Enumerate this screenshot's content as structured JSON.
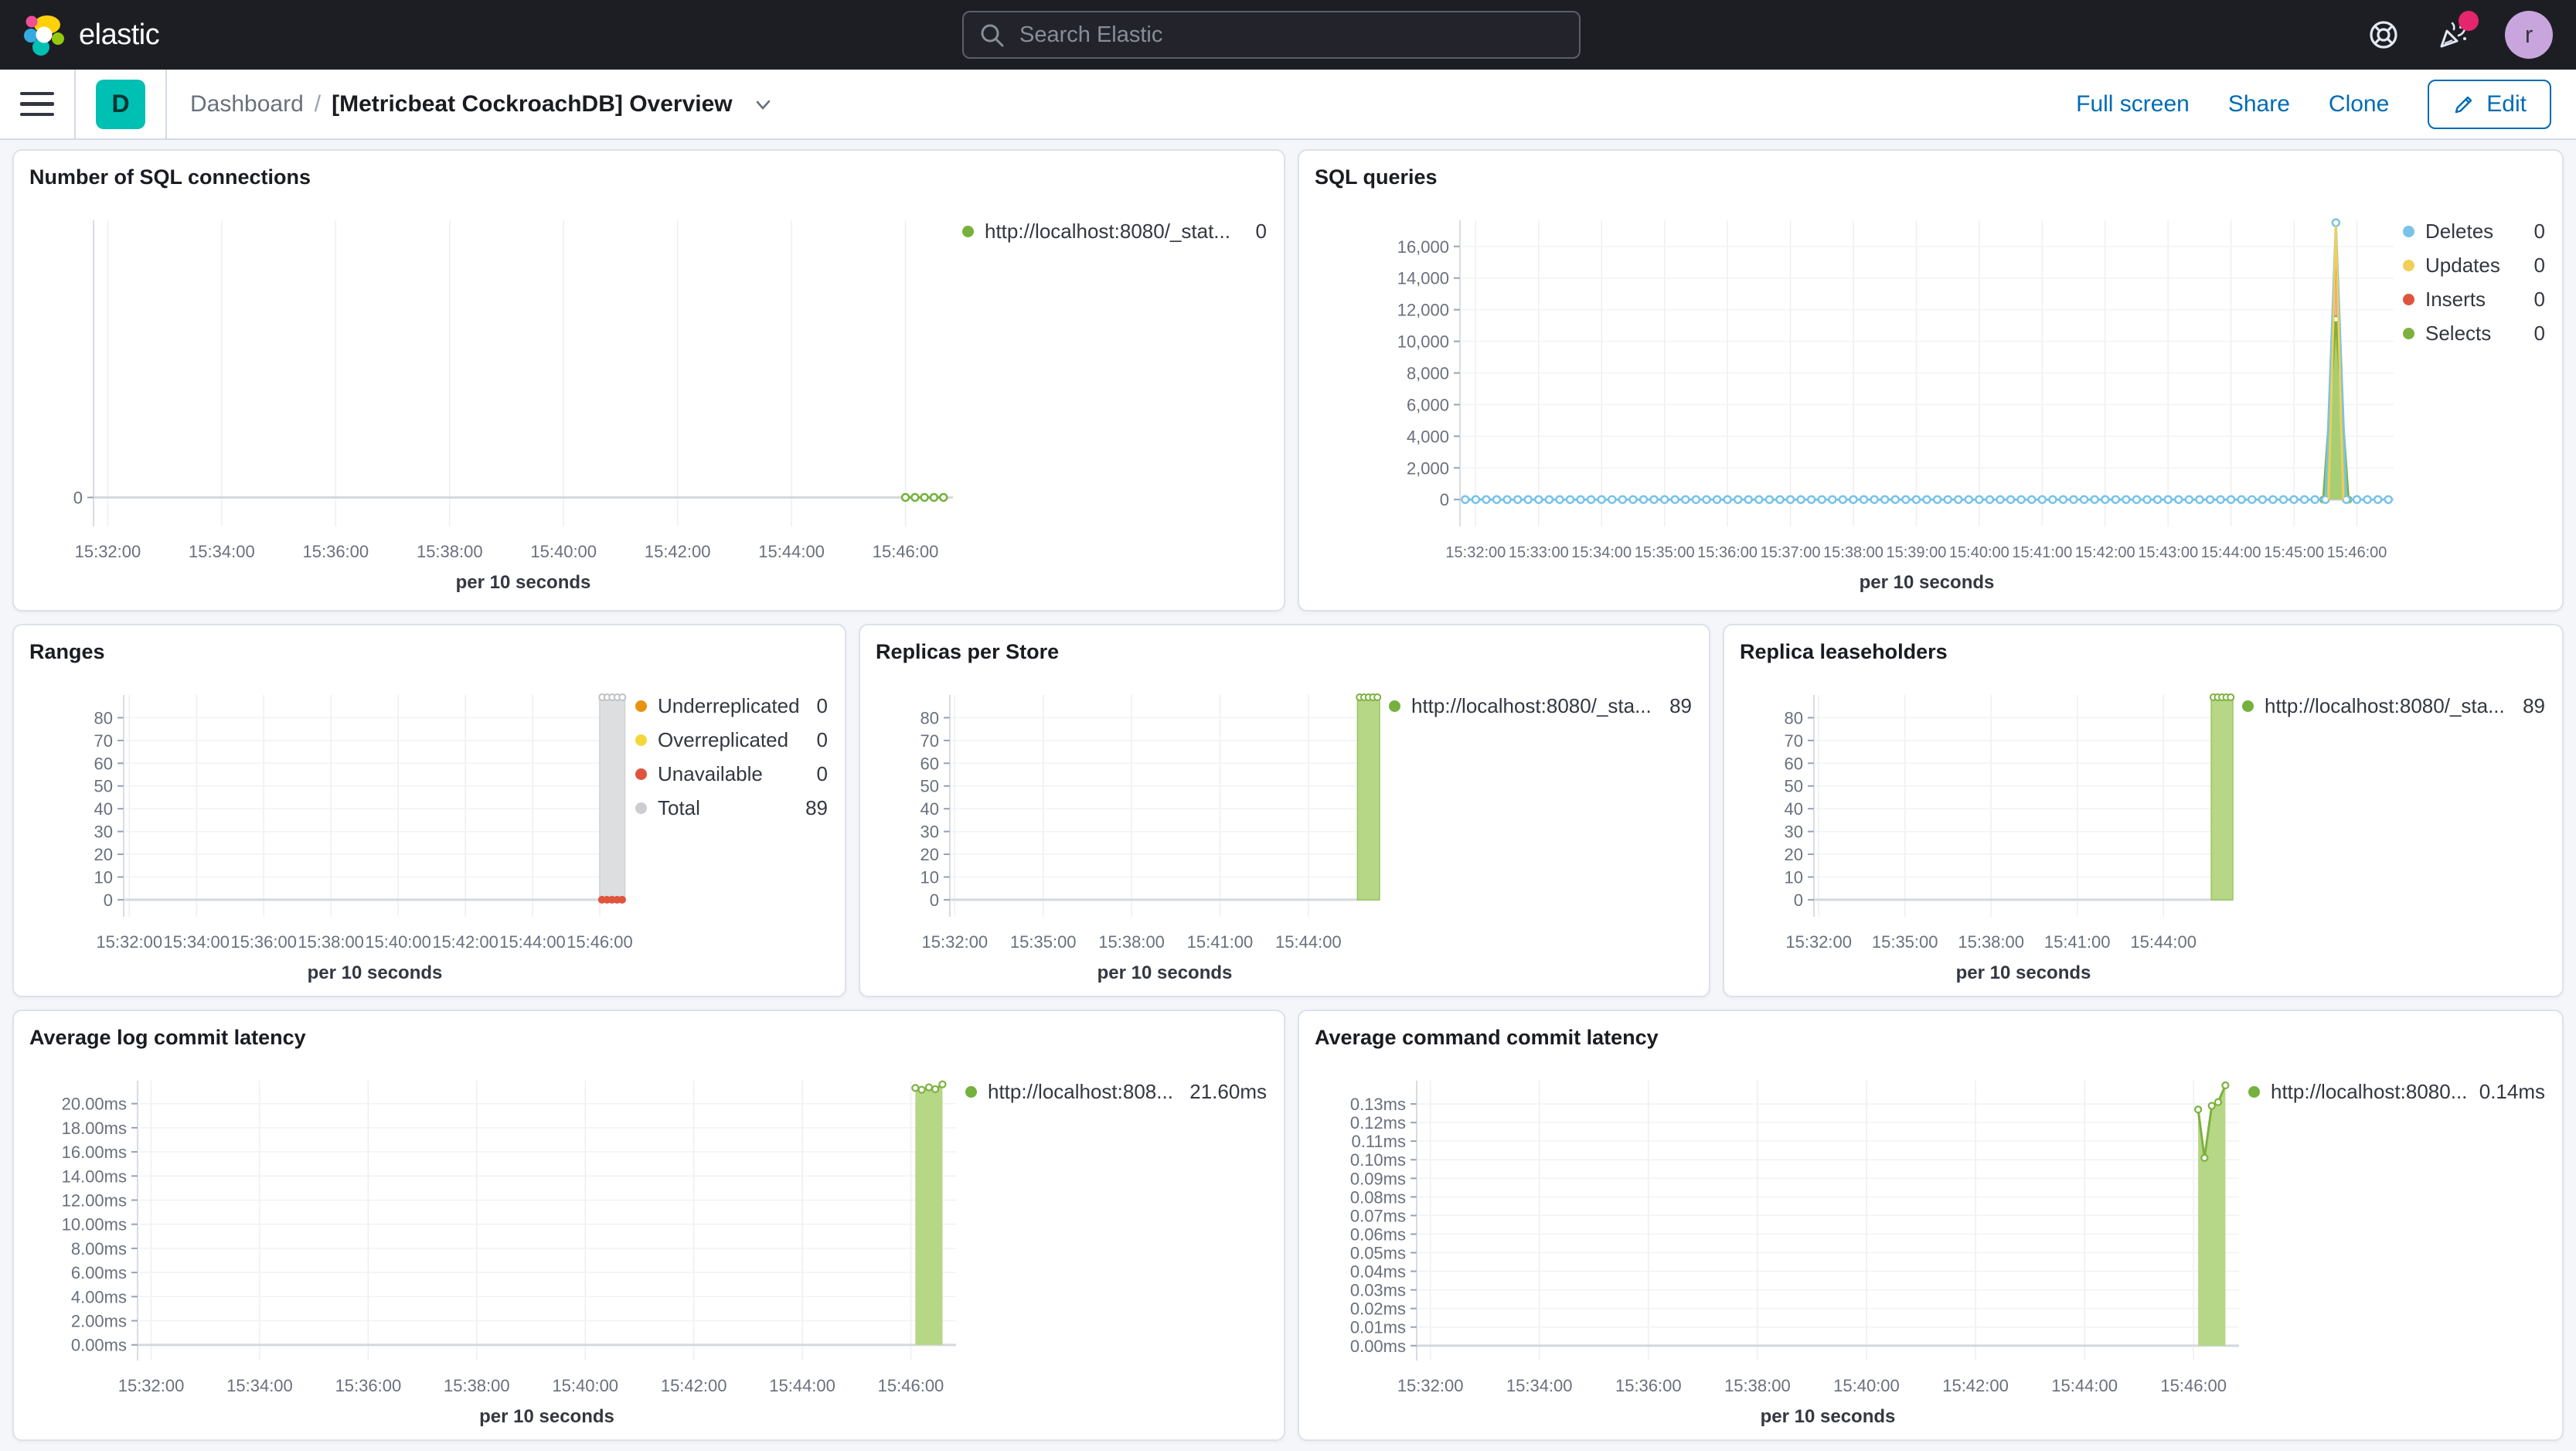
{
  "topbar": {
    "brand": "elastic",
    "search_placeholder": "Search Elastic",
    "avatar_initial": "r"
  },
  "toolbar": {
    "badge_letter": "D",
    "breadcrumb_root": "Dashboard",
    "separator": "/",
    "title": "[Metricbeat CockroachDB] Overview",
    "actions": [
      "Full screen",
      "Share",
      "Clone"
    ],
    "edit_label": "Edit"
  },
  "colors": {
    "topbar_bg": "#1D1E24",
    "primary_blue": "#006BB4",
    "badge_teal": "#00BFB3",
    "avatar_purple": "#C8A5DC",
    "notification_pink": "#E5256E",
    "series_green": "#75B13C",
    "series_green_fill": "#B5D786",
    "series_blue": "#79C3E8",
    "series_yellow": "#F1CF57",
    "series_red": "#E0543E",
    "series_orange": "#E8920D",
    "series_gray": "#CBCDD0"
  },
  "chart_data": [
    {
      "type": "line",
      "title": "Number of SQL connections",
      "xlabel": "per 10 seconds",
      "x_domain": [
        "15:31:45",
        "15:46:50"
      ],
      "x_ticks": [
        "15:32:00",
        "15:34:00",
        "15:36:00",
        "15:38:00",
        "15:40:00",
        "15:42:00",
        "15:44:00",
        "15:46:00"
      ],
      "ylim": [
        -0.9,
        8.6
      ],
      "y_ticks": [
        {
          "v": 0,
          "label": "0"
        }
      ],
      "series": [
        {
          "name": "http://localhost:8080/_stat...",
          "type": "line",
          "color": "#75B13C",
          "marker": true,
          "points": [
            {
              "from": "15:46:00",
              "to": "15:46:40",
              "step": 10,
              "v": 0
            }
          ]
        }
      ],
      "legend": [
        {
          "color": "#75B13C",
          "label": "http://localhost:8080/_stat...",
          "value": "0"
        }
      ]
    },
    {
      "type": "line",
      "title": "SQL queries",
      "xlabel": "per 10 seconds",
      "x_domain": [
        "15:31:45",
        "15:46:35"
      ],
      "x_ticks": [
        "15:32:00",
        "15:33:00",
        "15:34:00",
        "15:35:00",
        "15:36:00",
        "15:37:00",
        "15:38:00",
        "15:39:00",
        "15:40:00",
        "15:41:00",
        "15:42:00",
        "15:43:00",
        "15:44:00",
        "15:45:00",
        "15:46:00"
      ],
      "ylim": [
        -1700,
        17650
      ],
      "y_ticks": [
        {
          "v": 0,
          "label": "0"
        },
        {
          "v": 2000,
          "label": "2,000"
        },
        {
          "v": 4000,
          "label": "4,000"
        },
        {
          "v": 6000,
          "label": "6,000"
        },
        {
          "v": 8000,
          "label": "8,000"
        },
        {
          "v": 10000,
          "label": "10,000"
        },
        {
          "v": 12000,
          "label": "12,000"
        },
        {
          "v": 14000,
          "label": "14,000"
        },
        {
          "v": 16000,
          "label": "16,000"
        }
      ],
      "series": [
        {
          "name": "Inserts",
          "type": "area",
          "color": "#E0543E",
          "fill": "#E0543E",
          "fill_opacity": 0.45,
          "marker": false,
          "points": [
            {
              "t": "15:45:33",
              "v": 0
            },
            {
              "t": "15:45:40",
              "v": 17100
            },
            {
              "t": "15:45:47",
              "v": 0
            }
          ]
        },
        {
          "name": "Selects",
          "type": "area",
          "color": "#7DB13E",
          "fill": "#A8CE74",
          "fill_opacity": 1,
          "marker": true,
          "points": [
            {
              "t": "15:45:28",
              "v": 0
            },
            {
              "t": "15:45:40",
              "v": 11400
            },
            {
              "t": "15:45:52",
              "v": 0
            }
          ]
        },
        {
          "name": "Updates",
          "type": "line",
          "color": "#F1CF57",
          "marker": false,
          "points": [
            {
              "t": "15:45:33",
              "v": 0
            },
            {
              "t": "15:45:40",
              "v": 17300
            },
            {
              "t": "15:45:47",
              "v": 0
            }
          ]
        },
        {
          "name": "Deletes",
          "type": "line",
          "color": "#79C3E8",
          "marker": true,
          "points": [
            {
              "from": "15:31:50",
              "to": "15:45:20",
              "step": 10,
              "v": 0
            },
            {
              "t": "15:45:30",
              "v": 0
            },
            {
              "t": "15:45:40",
              "v": 17500
            },
            {
              "t": "15:45:50",
              "v": 0
            },
            {
              "from": "15:46:00",
              "to": "15:46:30",
              "step": 10,
              "v": 0
            }
          ]
        }
      ],
      "legend": [
        {
          "color": "#79C3E8",
          "label": "Deletes",
          "value": "0"
        },
        {
          "color": "#F1CF57",
          "label": "Updates",
          "value": "0"
        },
        {
          "color": "#E0543E",
          "label": "Inserts",
          "value": "0"
        },
        {
          "color": "#7DB13E",
          "label": "Selects",
          "value": "0"
        }
      ]
    },
    {
      "type": "bar",
      "title": "Ranges",
      "xlabel": "per 10 seconds",
      "x_domain": [
        "15:31:50",
        "15:46:47"
      ],
      "x_ticks": [
        "15:32:00",
        "15:34:00",
        "15:36:00",
        "15:38:00",
        "15:40:00",
        "15:42:00",
        "15:44:00",
        "15:46:00"
      ],
      "ylim": [
        -7.5,
        90
      ],
      "y_ticks": [
        {
          "v": 0,
          "label": "0"
        },
        {
          "v": 10,
          "label": "10"
        },
        {
          "v": 20,
          "label": "20"
        },
        {
          "v": 30,
          "label": "30"
        },
        {
          "v": 40,
          "label": "40"
        },
        {
          "v": 50,
          "label": "50"
        },
        {
          "v": 60,
          "label": "60"
        },
        {
          "v": 70,
          "label": "70"
        },
        {
          "v": 80,
          "label": "80"
        }
      ],
      "series": [
        {
          "name": "Total",
          "type": "bar",
          "fill": "#DDDEE0",
          "color": "#CFD0D2",
          "top_markers": 5,
          "marker_color": "#BFC1C4",
          "points": [
            {
              "t0": "15:46:00",
              "t1": "15:46:45",
              "v": 89
            }
          ]
        },
        {
          "name": "Unavailable",
          "type": "dots",
          "color": "#E0543E",
          "points": [
            {
              "t": "15:46:04",
              "v": 0
            },
            {
              "t": "15:46:13",
              "v": 0
            },
            {
              "t": "15:46:22",
              "v": 0
            },
            {
              "t": "15:46:31",
              "v": 0
            },
            {
              "t": "15:46:40",
              "v": 0
            }
          ]
        }
      ],
      "legend": [
        {
          "color": "#E8920D",
          "label": "Underreplicated",
          "value": "0"
        },
        {
          "color": "#F5D63A",
          "label": "Overreplicated",
          "value": "0"
        },
        {
          "color": "#E0543E",
          "label": "Unavailable",
          "value": "0"
        },
        {
          "color": "#CBCDD0",
          "label": "Total",
          "value": "89"
        }
      ]
    },
    {
      "type": "bar",
      "title": "Replicas per Store",
      "xlabel": "per 10 seconds",
      "x_domain": [
        "15:31:50",
        "15:46:25"
      ],
      "x_ticks": [
        "15:32:00",
        "15:35:00",
        "15:38:00",
        "15:41:00",
        "15:44:00"
      ],
      "ylim": [
        -7.5,
        90
      ],
      "y_ticks": [
        {
          "v": 0,
          "label": "0"
        },
        {
          "v": 10,
          "label": "10"
        },
        {
          "v": 20,
          "label": "20"
        },
        {
          "v": 30,
          "label": "30"
        },
        {
          "v": 40,
          "label": "40"
        },
        {
          "v": 50,
          "label": "50"
        },
        {
          "v": 60,
          "label": "60"
        },
        {
          "v": 70,
          "label": "70"
        },
        {
          "v": 80,
          "label": "80"
        }
      ],
      "series": [
        {
          "name": "http://localhost:8080/_sta...",
          "type": "bar",
          "fill": "#B5D786",
          "color": "#9CC45F",
          "top_markers": 5,
          "marker_color": "#7DB13E",
          "points": [
            {
              "t0": "15:45:40",
              "t1": "15:46:25",
              "v": 89
            }
          ]
        }
      ],
      "legend": [
        {
          "color": "#75B13C",
          "label": "http://localhost:8080/_sta...",
          "value": "89"
        }
      ]
    },
    {
      "type": "bar",
      "title": "Replica leaseholders",
      "xlabel": "per 10 seconds",
      "x_domain": [
        "15:31:50",
        "15:46:25"
      ],
      "x_ticks": [
        "15:32:00",
        "15:35:00",
        "15:38:00",
        "15:41:00",
        "15:44:00"
      ],
      "ylim": [
        -7.5,
        90
      ],
      "y_ticks": [
        {
          "v": 0,
          "label": "0"
        },
        {
          "v": 10,
          "label": "10"
        },
        {
          "v": 20,
          "label": "20"
        },
        {
          "v": 30,
          "label": "30"
        },
        {
          "v": 40,
          "label": "40"
        },
        {
          "v": 50,
          "label": "50"
        },
        {
          "v": 60,
          "label": "60"
        },
        {
          "v": 70,
          "label": "70"
        },
        {
          "v": 80,
          "label": "80"
        }
      ],
      "series": [
        {
          "name": "http://localhost:8080/_sta...",
          "type": "bar",
          "fill": "#B5D786",
          "color": "#9CC45F",
          "top_markers": 5,
          "marker_color": "#7DB13E",
          "points": [
            {
              "t0": "15:45:40",
              "t1": "15:46:25",
              "v": 89
            }
          ]
        }
      ],
      "legend": [
        {
          "color": "#75B13C",
          "label": "http://localhost:8080/_sta...",
          "value": "89"
        }
      ]
    },
    {
      "type": "area",
      "title": "Average log commit latency",
      "xlabel": "per 10 seconds",
      "x_domain": [
        "15:31:45",
        "15:46:50"
      ],
      "x_ticks": [
        "15:32:00",
        "15:34:00",
        "15:36:00",
        "15:38:00",
        "15:40:00",
        "15:42:00",
        "15:44:00",
        "15:46:00"
      ],
      "ylim": [
        -1.3,
        21.9
      ],
      "y_ticks": [
        {
          "v": 0,
          "label": "0.00ms"
        },
        {
          "v": 2,
          "label": "2.00ms"
        },
        {
          "v": 4,
          "label": "4.00ms"
        },
        {
          "v": 6,
          "label": "6.00ms"
        },
        {
          "v": 8,
          "label": "8.00ms"
        },
        {
          "v": 10,
          "label": "10.00ms"
        },
        {
          "v": 12,
          "label": "12.00ms"
        },
        {
          "v": 14,
          "label": "14.00ms"
        },
        {
          "v": 16,
          "label": "16.00ms"
        },
        {
          "v": 18,
          "label": "18.00ms"
        },
        {
          "v": 20,
          "label": "20.00ms"
        }
      ],
      "series": [
        {
          "name": "http://localhost:808...",
          "type": "area",
          "color": "#7DB13E",
          "fill": "#B5D786",
          "fill_opacity": 1,
          "marker": true,
          "points": [
            {
              "t": "15:46:05",
              "v": 21.3
            },
            {
              "t": "15:46:12",
              "v": 21.15
            },
            {
              "t": "15:46:20",
              "v": 21.35
            },
            {
              "t": "15:46:27",
              "v": 21.2
            },
            {
              "t": "15:46:35",
              "v": 21.6
            }
          ]
        }
      ],
      "legend": [
        {
          "color": "#75B13C",
          "label": "http://localhost:808...",
          "value": "21.60ms"
        }
      ]
    },
    {
      "type": "area",
      "title": "Average command commit latency",
      "xlabel": "per 10 seconds",
      "x_domain": [
        "15:31:45",
        "15:46:50"
      ],
      "x_ticks": [
        "15:32:00",
        "15:34:00",
        "15:36:00",
        "15:38:00",
        "15:40:00",
        "15:42:00",
        "15:44:00",
        "15:46:00"
      ],
      "ylim": [
        -0.008,
        0.1425
      ],
      "y_ticks": [
        {
          "v": 0,
          "label": "0.00ms"
        },
        {
          "v": 0.01,
          "label": "0.01ms"
        },
        {
          "v": 0.02,
          "label": "0.02ms"
        },
        {
          "v": 0.03,
          "label": "0.03ms"
        },
        {
          "v": 0.04,
          "label": "0.04ms"
        },
        {
          "v": 0.05,
          "label": "0.05ms"
        },
        {
          "v": 0.06,
          "label": "0.06ms"
        },
        {
          "v": 0.07,
          "label": "0.07ms"
        },
        {
          "v": 0.08,
          "label": "0.08ms"
        },
        {
          "v": 0.09,
          "label": "0.09ms"
        },
        {
          "v": 0.1,
          "label": "0.10ms"
        },
        {
          "v": 0.11,
          "label": "0.11ms"
        },
        {
          "v": 0.12,
          "label": "0.12ms"
        },
        {
          "v": 0.13,
          "label": "0.13ms"
        }
      ],
      "series": [
        {
          "name": "http://localhost:8080...",
          "type": "area",
          "color": "#7DB13E",
          "fill": "#B5D786",
          "fill_opacity": 1,
          "marker": true,
          "points": [
            {
              "t": "15:46:05",
              "v": 0.127
            },
            {
              "t": "15:46:12",
              "v": 0.101
            },
            {
              "t": "15:46:20",
              "v": 0.129
            },
            {
              "t": "15:46:27",
              "v": 0.131
            },
            {
              "t": "15:46:35",
              "v": 0.14
            }
          ]
        }
      ],
      "legend": [
        {
          "color": "#75B13C",
          "label": "http://localhost:8080...",
          "value": "0.14ms"
        }
      ]
    }
  ]
}
